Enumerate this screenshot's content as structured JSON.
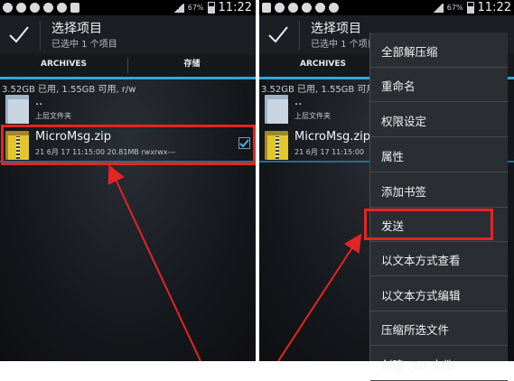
{
  "left": {
    "status_time": "11:22",
    "battery_pct": "67%",
    "title": "选择项目",
    "subtitle": "已选中 1 个项目",
    "tabs": [
      "ARCHIVES",
      "存储"
    ],
    "storage_info": "3.52GB 已用, 1.55GB 可用, r/w",
    "rows": [
      {
        "name": "..",
        "meta": "上层文件夹"
      },
      {
        "name": "MicroMsg.zip",
        "meta": "21 6月 17 11:15:00  20.81MB  rwxrwx---"
      }
    ]
  },
  "right": {
    "status_time": "11:22",
    "battery_pct": "67%",
    "title": "选择项目",
    "subtitle": "已选中 1 个项目",
    "tabs": [
      "ARCHIVES",
      "存"
    ],
    "storage_info": "3.52GB 已用, 1.55GB 可用",
    "rows": [
      {
        "name": "..",
        "meta": "上层文件夹"
      },
      {
        "name": "MicroMsg.zip",
        "meta": "21 6月 17 11:15:00"
      }
    ]
  },
  "context_menu": {
    "items": [
      "全部解压缩",
      "重命名",
      "权限设定",
      "属性",
      "添加书签",
      "发送",
      "以文本方式查看",
      "以文本方式编辑",
      "压缩所选文件",
      "创建 .Tar 文件"
    ]
  },
  "colors": {
    "annotation": "#e52424",
    "accent": "#36a6d6"
  }
}
